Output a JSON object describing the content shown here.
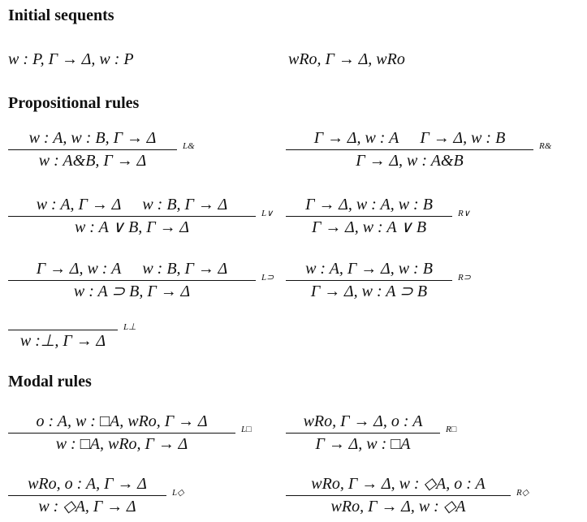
{
  "sections": {
    "initial": "Initial sequents",
    "propositional": "Propositional rules",
    "modal": "Modal rules"
  },
  "initial": [
    "w : P, Γ → Δ, w : P",
    "wRo, Γ → Δ, wRo"
  ],
  "rules": {
    "land": {
      "premises": [
        "w : A, w : B, Γ → Δ"
      ],
      "conclusion": "w : A&B, Γ → Δ",
      "label": "L&"
    },
    "rand": {
      "premises": [
        "Γ → Δ, w : A",
        "Γ → Δ, w : B"
      ],
      "conclusion": "Γ → Δ, w : A&B",
      "label": "R&"
    },
    "lor": {
      "premises": [
        "w : A, Γ → Δ",
        "w : B, Γ → Δ"
      ],
      "conclusion": "w : A ∨ B, Γ → Δ",
      "label": "L∨"
    },
    "ror": {
      "premises": [
        "Γ → Δ, w : A, w : B"
      ],
      "conclusion": "Γ → Δ, w : A ∨ B",
      "label": "R∨"
    },
    "limp": {
      "premises": [
        "Γ → Δ, w : A",
        "w : B, Γ → Δ"
      ],
      "conclusion": "w : A ⊃ B, Γ → Δ",
      "label": "L⊃"
    },
    "rimp": {
      "premises": [
        "w : A, Γ → Δ, w : B"
      ],
      "conclusion": "Γ → Δ, w : A ⊃ B",
      "label": "R⊃"
    },
    "lbot": {
      "premises": [
        ""
      ],
      "conclusion": "w :⊥, Γ → Δ",
      "label": "L⊥"
    },
    "lbox": {
      "premises": [
        "o : A, w : □A, wRo, Γ → Δ"
      ],
      "conclusion": "w : □A, wRo, Γ → Δ",
      "label": "L□"
    },
    "rbox": {
      "premises": [
        "wRo, Γ → Δ, o : A"
      ],
      "conclusion": "Γ → Δ, w : □A",
      "label": "R□"
    },
    "ldia": {
      "premises": [
        "wRo, o : A, Γ → Δ"
      ],
      "conclusion": "w : ◇A, Γ → Δ",
      "label": "L◇"
    },
    "rdia": {
      "premises": [
        "wRo, Γ → Δ, w : ◇A, o : A"
      ],
      "conclusion": "wRo, Γ → Δ, w : ◇A",
      "label": "R◇"
    }
  }
}
